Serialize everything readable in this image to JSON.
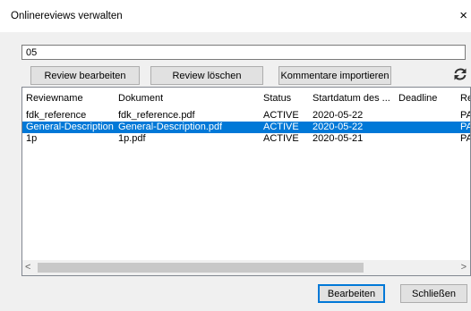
{
  "window": {
    "title": "Onlinereviews verwalten",
    "close_glyph": "×"
  },
  "search": {
    "value": "05"
  },
  "toolbar": {
    "edit_review": "Review bearbeiten",
    "delete_review": "Review löschen",
    "import_comments": "Kommentare importieren",
    "refresh_icon": "refresh-icon"
  },
  "table": {
    "columns": [
      "Reviewname",
      "Dokument",
      "Status",
      "Startdatum des ...",
      "Deadline",
      "Re"
    ],
    "rows": [
      {
        "name": "fdk_reference",
        "document": "fdk_reference.pdf",
        "status": "ACTIVE",
        "start": "2020-05-22",
        "deadline": "",
        "re": "PA"
      },
      {
        "name": "General-Description",
        "document": "General-Description.pdf",
        "status": "ACTIVE",
        "start": "2020-05-22",
        "deadline": "",
        "re": "PA"
      },
      {
        "name": "1p",
        "document": "1p.pdf",
        "status": "ACTIVE",
        "start": "2020-05-21",
        "deadline": "",
        "re": "PA"
      }
    ],
    "selected_row": 1
  },
  "scrollbar": {
    "left_glyph": "<",
    "right_glyph": ">"
  },
  "footer": {
    "edit": "Bearbeiten",
    "close": "Schließen"
  },
  "colors": {
    "selection": "#0078d7",
    "default_button_border": "#0078d7"
  }
}
